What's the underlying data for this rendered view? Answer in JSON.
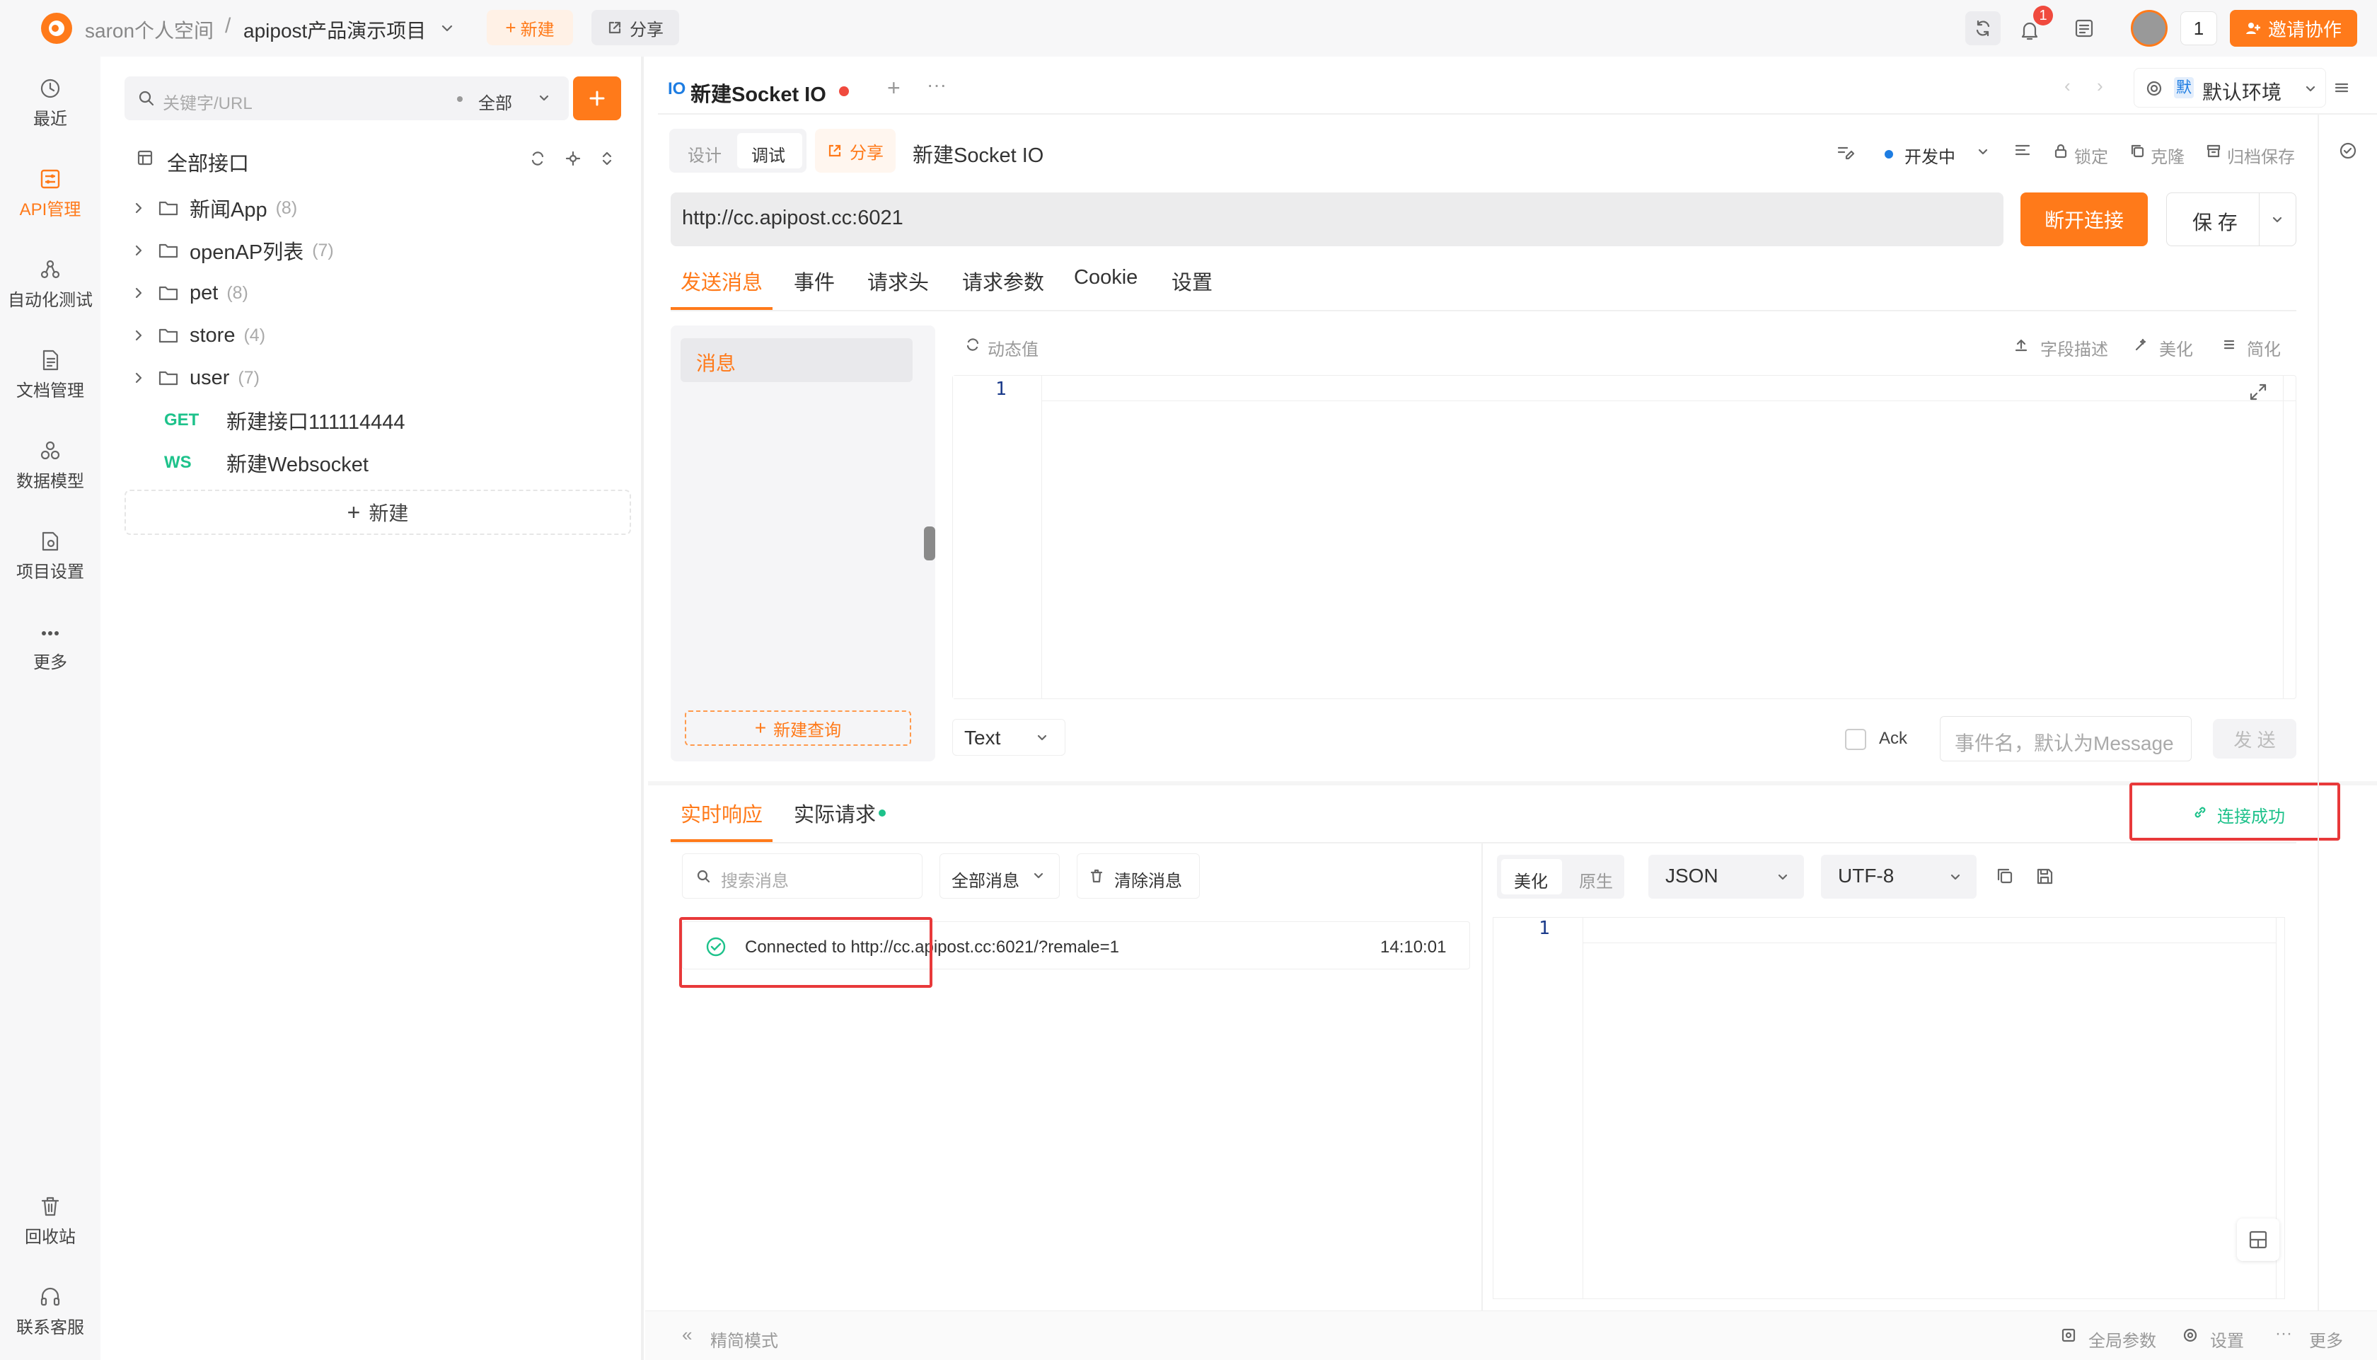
{
  "topbar": {
    "workspace": "saron个人空间",
    "separator": "/",
    "project": "apipost产品演示项目",
    "new_label": "新建",
    "share_label": "分享",
    "notification_count": "1",
    "online_count": "1",
    "invite_label": "邀请协作"
  },
  "leftnav": {
    "items": [
      {
        "label": "最近",
        "icon": "clock-icon"
      },
      {
        "label": "API管理",
        "icon": "api-icon"
      },
      {
        "label": "自动化测试",
        "icon": "automation-icon"
      },
      {
        "label": "文档管理",
        "icon": "document-icon"
      },
      {
        "label": "数据模型",
        "icon": "model-icon"
      },
      {
        "label": "项目设置",
        "icon": "settings-icon"
      },
      {
        "label": "更多",
        "icon": "more-icon"
      }
    ],
    "bottom": [
      {
        "label": "回收站",
        "icon": "trash-icon"
      },
      {
        "label": "联系客服",
        "icon": "headset-icon"
      }
    ]
  },
  "sidebar": {
    "search_placeholder": "关键字/URL",
    "filter": "全部",
    "root_label": "全部接口",
    "folders": [
      {
        "name": "新闻App",
        "count": "(8)"
      },
      {
        "name": "openAP列表",
        "count": "(7)"
      },
      {
        "name": "pet",
        "count": "(8)"
      },
      {
        "name": "store",
        "count": "(4)"
      },
      {
        "name": "user",
        "count": "(7)"
      }
    ],
    "apis": [
      {
        "method": "GET",
        "name": "新建接口111114444"
      },
      {
        "method": "WS",
        "name": "新建Websocket"
      }
    ],
    "new_label": "新建"
  },
  "editor": {
    "tab_prefix": "IO",
    "tab_title": "新建Socket IO",
    "env_badge": "默",
    "env_label": "默认环境",
    "mode_design": "设计",
    "mode_debug": "调试",
    "share_label": "分享",
    "api_name": "新建Socket IO",
    "status_label": "开发中",
    "lock_label": "锁定",
    "clone_label": "克隆",
    "archive_label": "归档保存",
    "url": "http://cc.apipost.cc:6021",
    "disconnect_label": "断开连接",
    "save_label": "保 存",
    "subtabs": [
      "发送消息",
      "事件",
      "请求头",
      "请求参数",
      "Cookie",
      "设置"
    ],
    "message_item": "消息",
    "new_query_label": "新建查询",
    "dynamic_label": "动态值",
    "field_desc_label": "字段描述",
    "beautify_label": "美化",
    "simplify_label": "简化",
    "line_number": "1",
    "type_select": "Text",
    "ack_label": "Ack",
    "event_placeholder": "事件名，默认为Message",
    "send_label": "发 送"
  },
  "response": {
    "tabs": [
      "实时响应",
      "实际请求"
    ],
    "connected_label": "连接成功",
    "search_placeholder": "搜索消息",
    "filter_label": "全部消息",
    "clear_label": "清除消息",
    "log": {
      "text": "Connected to http://cc.apipost.cc:6021/?remale=1",
      "time": "14:10:01"
    },
    "view_beautify": "美化",
    "view_raw": "原生",
    "format": "JSON",
    "encoding": "UTF-8",
    "line_number": "1"
  },
  "footer": {
    "simple_mode": "精简模式",
    "global_params": "全局参数",
    "settings": "设置",
    "more": "更多"
  },
  "colors": {
    "accent": "#ff7a1a",
    "success": "#1ec28b",
    "highlight": "#e8393a",
    "ws": "#1ec28b"
  }
}
